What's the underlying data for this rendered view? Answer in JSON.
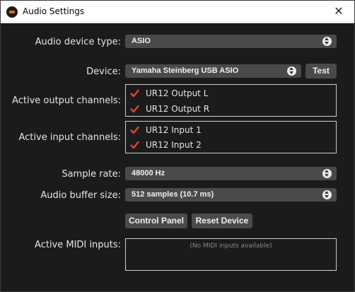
{
  "window": {
    "title": "Audio Settings",
    "close_glyph": "✕"
  },
  "labels": {
    "device_type": "Audio device type:",
    "device": "Device:",
    "output_channels": "Active output channels:",
    "input_channels": "Active input channels:",
    "sample_rate": "Sample rate:",
    "buffer_size": "Audio buffer size:",
    "midi_inputs": "Active MIDI inputs:"
  },
  "device_type": {
    "value": "ASIO"
  },
  "device": {
    "value": "Yamaha Steinberg USB ASIO",
    "test_label": "Test"
  },
  "output_channels": [
    {
      "label": "UR12 Output L",
      "checked": true
    },
    {
      "label": "UR12 Output R",
      "checked": true
    }
  ],
  "input_channels": [
    {
      "label": "UR12 Input 1",
      "checked": true
    },
    {
      "label": "UR12 Input 2",
      "checked": true
    }
  ],
  "sample_rate": {
    "value": "48000 Hz"
  },
  "buffer_size": {
    "value": "512 samples (10.7 ms)"
  },
  "buttons": {
    "control_panel": "Control Panel",
    "reset_device": "Reset Device"
  },
  "midi": {
    "empty_text": "(No MIDI inputs available)"
  },
  "colors": {
    "check": "#e0453a",
    "combo_bg": "#4a4a4a",
    "bg": "#1b1b1b"
  },
  "icons": {
    "app": "app-logo-icon",
    "check": "checkmark-icon",
    "chevron": "chevron-updown-icon"
  }
}
